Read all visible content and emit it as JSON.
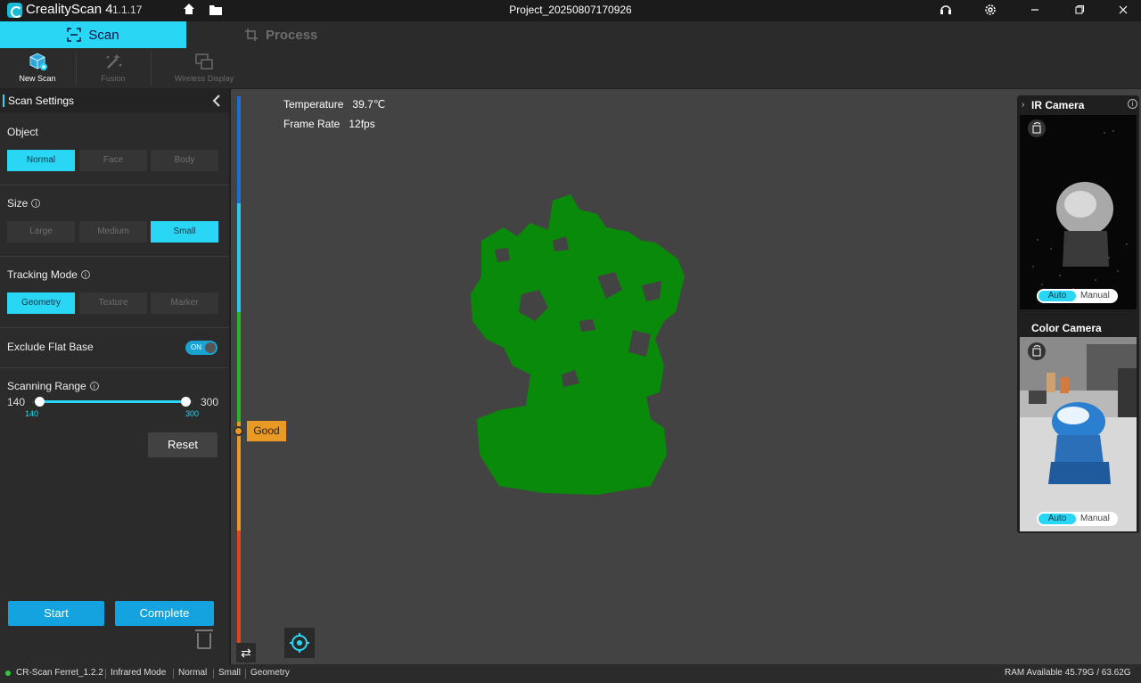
{
  "titlebar": {
    "app_name": "CrealityScan 4",
    "version": "1.1.17",
    "project": "Project_20250807170926"
  },
  "modes": {
    "scan": "Scan",
    "process": "Process"
  },
  "toolbar": {
    "new_scan": "New Scan",
    "fusion": "Fusion",
    "wireless": "Wireless Display"
  },
  "panel": {
    "title": "Scan Settings",
    "object": {
      "label": "Object",
      "options": [
        "Normal",
        "Face",
        "Body"
      ],
      "selected": "Normal"
    },
    "size": {
      "label": "Size",
      "options": [
        "Large",
        "Medium",
        "Small"
      ],
      "selected": "Small"
    },
    "tracking": {
      "label": "Tracking Mode",
      "options": [
        "Geometry",
        "Texture",
        "Marker"
      ],
      "selected": "Geometry"
    },
    "exclude": {
      "label": "Exclude Flat Base",
      "toggle": "ON"
    },
    "range": {
      "label": "Scanning Range",
      "min": "140",
      "max": "300",
      "low": "140",
      "high": "300"
    },
    "reset": "Reset",
    "start": "Start",
    "complete": "Complete"
  },
  "viewport": {
    "temperature_label": "Temperature",
    "temperature_value": "39.7℃",
    "framerate_label": "Frame Rate",
    "framerate_value": "12fps",
    "quality": "Good"
  },
  "cameras": {
    "ir_title": "IR Camera",
    "color_title": "Color Camera",
    "auto": "Auto",
    "manual": "Manual"
  },
  "status": {
    "device": "CR-Scan Ferret_1.2.2",
    "mode": "Infrared Mode",
    "object": "Normal",
    "size": "Small",
    "tracking": "Geometry",
    "ram": "RAM Available 45.79G / 63.62G"
  },
  "colors": {
    "accent": "#29d7f4",
    "scan_green": "#0a8a0a",
    "quality_orange": "#e89a25"
  }
}
